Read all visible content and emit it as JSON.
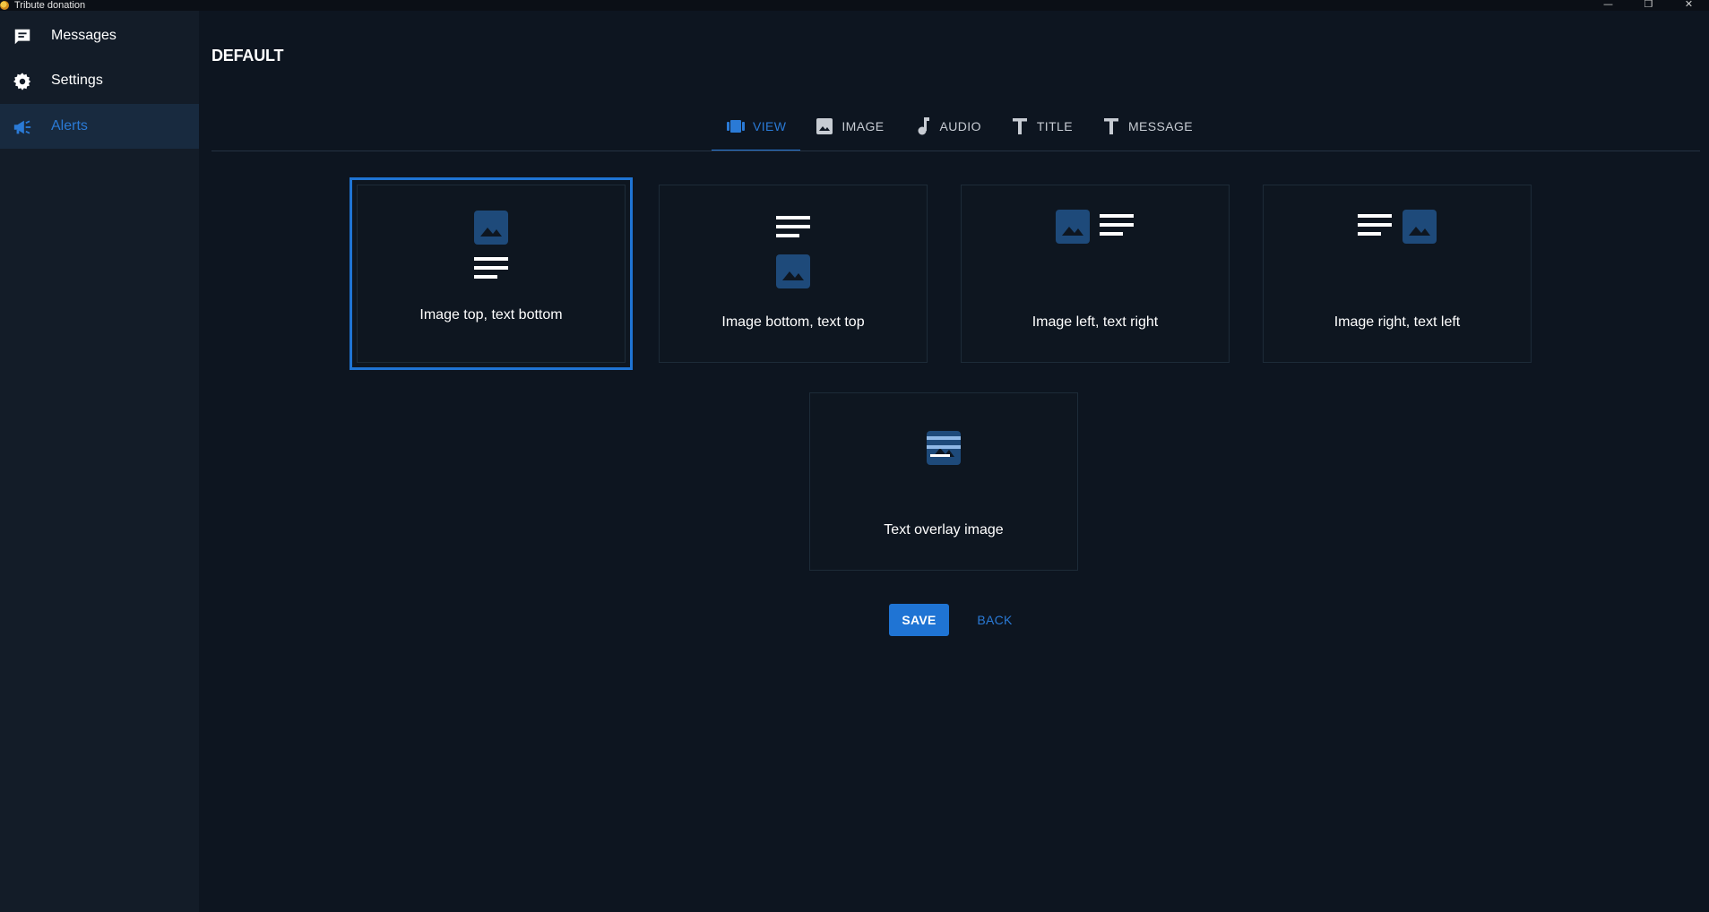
{
  "window": {
    "title": "Tribute donation",
    "controls": {
      "minimize": "—",
      "restore": "❐",
      "close": "✕"
    }
  },
  "sidebar": {
    "items": [
      {
        "label": "Messages",
        "icon": "message-icon",
        "active": false
      },
      {
        "label": "Settings",
        "icon": "gear-icon",
        "active": false
      },
      {
        "label": "Alerts",
        "icon": "megaphone-icon",
        "active": true
      }
    ]
  },
  "page": {
    "title": "DEFAULT"
  },
  "tabs": [
    {
      "label": "VIEW",
      "icon": "view-carousel-icon",
      "active": true
    },
    {
      "label": "IMAGE",
      "icon": "image-icon",
      "active": false
    },
    {
      "label": "AUDIO",
      "icon": "music-note-icon",
      "active": false
    },
    {
      "label": "TITLE",
      "icon": "text-t-icon",
      "active": false
    },
    {
      "label": "MESSAGE",
      "icon": "text-t-icon",
      "active": false
    }
  ],
  "layouts": [
    {
      "label": "Image top, text bottom",
      "selected": true
    },
    {
      "label": "Image bottom, text top",
      "selected": false
    },
    {
      "label": "Image left, text right",
      "selected": false
    },
    {
      "label": "Image right, text left",
      "selected": false
    },
    {
      "label": "Text overlay image",
      "selected": false
    }
  ],
  "actions": {
    "save_label": "SAVE",
    "back_label": "BACK"
  },
  "colors": {
    "background": "#0d1520",
    "sidebar": "#131c28",
    "accent": "#1f74d4",
    "image_glyph": "#1e4a7a"
  }
}
